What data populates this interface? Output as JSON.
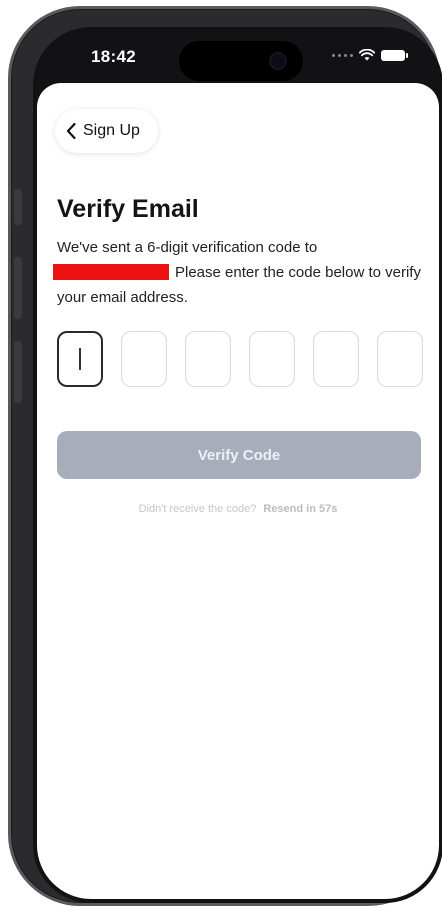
{
  "status_bar": {
    "time": "18:42",
    "icons": [
      "cellular-dots-icon",
      "wifi-icon",
      "battery-icon"
    ]
  },
  "nav": {
    "back_label": "Sign Up",
    "back_icon": "chevron-left-icon"
  },
  "page": {
    "title": "Verify Email",
    "description_prefix": "We've sent a 6-digit verification code to",
    "description_suffix": "Please enter the code below to verify your email address."
  },
  "code_input": {
    "length": 6,
    "values": [
      "",
      "",
      "",
      "",
      "",
      ""
    ],
    "active_index": 0
  },
  "verify_button": {
    "label": "Verify Code",
    "disabled": true,
    "color": "#a7adbb"
  },
  "resend": {
    "prompt": "Didn't receive the code?",
    "link": "Resend in 57s"
  },
  "colors": {
    "redaction": "#ee1111",
    "active_border": "#2a2a2a",
    "inactive_border": "#d9d9dc"
  }
}
